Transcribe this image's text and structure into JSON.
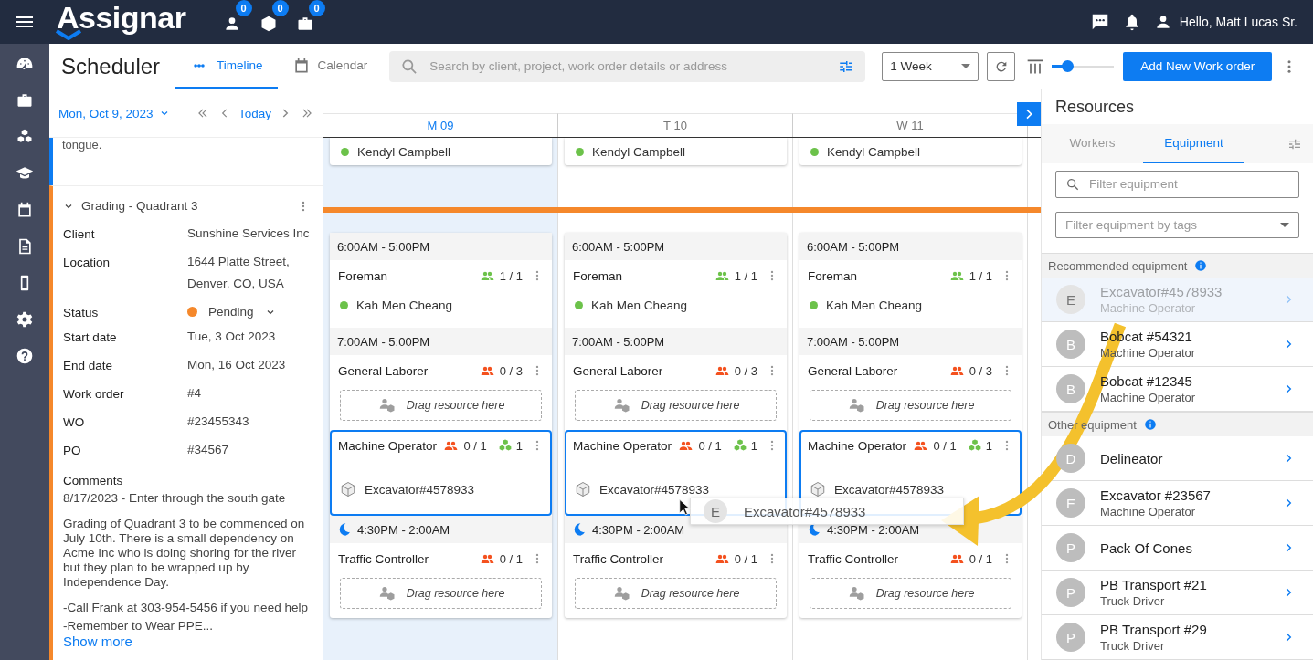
{
  "topbar": {
    "logo": "Assignar",
    "badges": [
      {
        "kind": "person",
        "count": "0"
      },
      {
        "kind": "cube",
        "count": "0"
      },
      {
        "kind": "briefcase",
        "count": "0"
      }
    ],
    "greeting": "Hello, Matt Lucas Sr."
  },
  "rail": [
    {
      "kind": "dashboard"
    },
    {
      "kind": "briefcase"
    },
    {
      "kind": "cubes"
    },
    {
      "kind": "training"
    },
    {
      "kind": "calendar"
    },
    {
      "kind": "document"
    },
    {
      "kind": "phone"
    },
    {
      "kind": "settings"
    },
    {
      "kind": "help"
    }
  ],
  "toolbar": {
    "title": "Scheduler",
    "tabs": [
      {
        "label": "Timeline",
        "kind": "timeline",
        "selected": true
      },
      {
        "label": "Calendar",
        "kind": "calendar",
        "selected": false
      }
    ],
    "search": {
      "placeholder": "Search by client, project, work order details or address"
    },
    "range": "1 Week",
    "zoom": {
      "level": 0.25
    },
    "add_button": "Add New Work order"
  },
  "date_nav": {
    "date": "Mon, Oct 9, 2023",
    "today": "Today"
  },
  "left_panel": {
    "previous_text": "tongue.",
    "project": {
      "title": "Grading - Quadrant 3",
      "fields": [
        {
          "kind": "text",
          "label": "Client",
          "value": "Sunshine Services Inc"
        },
        {
          "kind": "text",
          "label": "Location",
          "value": "1644 Platte Street, Denver, CO, USA"
        },
        {
          "kind": "status",
          "label": "Status",
          "value": "Pending",
          "color": "#f5882b"
        },
        {
          "kind": "text",
          "label": "Start date",
          "value": "Tue, 3 Oct 2023"
        },
        {
          "kind": "text",
          "label": "End date",
          "value": "Mon, 16 Oct 2023"
        },
        {
          "kind": "text",
          "label": "Work order",
          "value": "#4"
        },
        {
          "kind": "text",
          "label": "WO",
          "value": "#23455343"
        },
        {
          "kind": "text",
          "label": "PO",
          "value": "#34567"
        }
      ],
      "comments_label": "Comments",
      "comments": [
        "8/17/2023 - Enter through the south gate",
        "Grading of Quadrant 3 to be commenced on July 10th.  There is a small dependency on Acme Inc who is doing shoring for the river but they plan to be wrapped up by Independence Day.",
        "-Call Frank at 303-954-5456 if you need help",
        "-Remember to Wear PPE..."
      ],
      "show_more": "Show more"
    }
  },
  "schedule": {
    "columns": [
      {
        "day": "M 09",
        "selected": true,
        "worker": {
          "name": "Kendyl Campbell",
          "color": "#6cc24a"
        },
        "shifts": [
          {
            "time": "6:00AM - 5:00PM",
            "night": false,
            "roles": [
              {
                "name": "Foreman",
                "count": "1 / 1",
                "filled": true,
                "drop_target": false,
                "assigned": [
                  {
                    "kind": "worker",
                    "name": "Kah Men Cheang",
                    "color": "#6cc24a"
                  }
                ]
              }
            ]
          },
          {
            "time": "7:00AM - 5:00PM",
            "night": false,
            "roles": [
              {
                "name": "General Laborer",
                "count": "0 / 3",
                "filled": false,
                "drop_target": false,
                "drop_hint": "Drag resource here"
              },
              {
                "name": "Machine Operator",
                "count": "0 / 1",
                "filled": false,
                "equipment_count": "1",
                "drop_target": true,
                "assigned": [
                  {
                    "kind": "equipment",
                    "name": "Excavator#4578933"
                  }
                ]
              }
            ]
          },
          {
            "time": "4:30PM - 2:00AM",
            "night": true,
            "roles": [
              {
                "name": "Traffic Controller",
                "count": "0 / 1",
                "filled": false,
                "drop_target": false,
                "drop_hint": "Drag resource here"
              }
            ]
          }
        ]
      },
      {
        "day": "T 10",
        "selected": false,
        "worker": {
          "name": "Kendyl Campbell",
          "color": "#6cc24a"
        },
        "shifts": [
          {
            "time": "6:00AM - 5:00PM",
            "night": false,
            "roles": [
              {
                "name": "Foreman",
                "count": "1 / 1",
                "filled": true,
                "drop_target": false,
                "assigned": [
                  {
                    "kind": "worker",
                    "name": "Kah Men Cheang",
                    "color": "#6cc24a"
                  }
                ]
              }
            ]
          },
          {
            "time": "7:00AM - 5:00PM",
            "night": false,
            "roles": [
              {
                "name": "General Laborer",
                "count": "0 / 3",
                "filled": false,
                "drop_target": false,
                "drop_hint": "Drag resource here"
              },
              {
                "name": "Machine Operator",
                "count": "0 / 1",
                "filled": false,
                "equipment_count": "1",
                "drop_target": true,
                "assigned": [
                  {
                    "kind": "equipment",
                    "name": "Excavator#4578933"
                  }
                ]
              }
            ]
          },
          {
            "time": "4:30PM - 2:00AM",
            "night": true,
            "roles": [
              {
                "name": "Traffic Controller",
                "count": "0 / 1",
                "filled": false,
                "drop_target": false,
                "drop_hint": "Drag resource here"
              }
            ]
          }
        ]
      },
      {
        "day": "W 11",
        "selected": false,
        "worker": {
          "name": "Kendyl Campbell",
          "color": "#6cc24a"
        },
        "shifts": [
          {
            "time": "6:00AM - 5:00PM",
            "night": false,
            "roles": [
              {
                "name": "Foreman",
                "count": "1 / 1",
                "filled": true,
                "drop_target": false,
                "assigned": [
                  {
                    "kind": "worker",
                    "name": "Kah Men Cheang",
                    "color": "#6cc24a"
                  }
                ]
              }
            ]
          },
          {
            "time": "7:00AM - 5:00PM",
            "night": false,
            "roles": [
              {
                "name": "General Laborer",
                "count": "0 / 3",
                "filled": false,
                "drop_target": false,
                "drop_hint": "Drag resource here"
              },
              {
                "name": "Machine Operator",
                "count": "0 / 1",
                "filled": false,
                "equipment_count": "1",
                "drop_target": true,
                "assigned": [
                  {
                    "kind": "equipment",
                    "name": "Excavator#4578933"
                  }
                ]
              }
            ]
          },
          {
            "time": "4:30PM - 2:00AM",
            "night": true,
            "roles": [
              {
                "name": "Traffic Controller",
                "count": "0 / 1",
                "filled": false,
                "drop_target": false,
                "drop_hint": "Drag resource here"
              }
            ]
          }
        ]
      }
    ]
  },
  "drag_ghost": {
    "initial": "E",
    "name": "Excavator#4578933"
  },
  "resources": {
    "title": "Resources",
    "tabs": [
      {
        "label": "Workers",
        "selected": false
      },
      {
        "label": "Equipment",
        "selected": true
      }
    ],
    "filter": {
      "placeholder": "Filter equipment"
    },
    "tags": {
      "placeholder": "Filter equipment by tags"
    },
    "groups": [
      {
        "title": "Recommended equipment",
        "items": [
          {
            "initial": "E",
            "name": "Excavator#4578933",
            "role": "Machine Operator",
            "disabled": true
          },
          {
            "initial": "B",
            "name": "Bobcat #54321",
            "role": "Machine Operator",
            "disabled": false
          },
          {
            "initial": "B",
            "name": "Bobcat #12345",
            "role": "Machine Operator",
            "disabled": false
          }
        ]
      },
      {
        "title": "Other equipment",
        "items": [
          {
            "initial": "D",
            "name": "Delineator",
            "disabled": false
          },
          {
            "initial": "E",
            "name": "Excavator #23567",
            "role": "Machine Operator",
            "disabled": false
          },
          {
            "initial": "P",
            "name": "Pack Of Cones",
            "disabled": false
          },
          {
            "initial": "P",
            "name": "PB Transport #21",
            "role": "Truck Driver",
            "disabled": false
          },
          {
            "initial": "P",
            "name": "PB Transport #29",
            "role": "Truck Driver",
            "disabled": false
          }
        ]
      }
    ]
  }
}
